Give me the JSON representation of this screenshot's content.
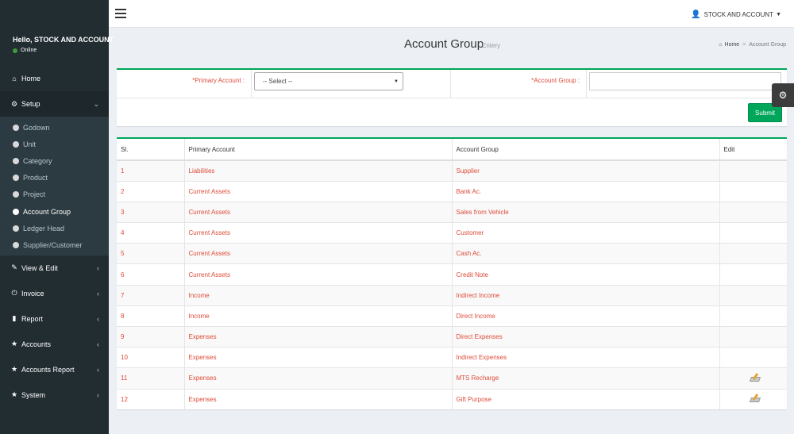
{
  "sidebar": {
    "user_name": "Hello, STOCK AND ACCOUNT",
    "status": "Online",
    "menu": [
      {
        "label": "Home",
        "icon": "home-icon"
      },
      {
        "label": "Setup",
        "icon": "gears-icon"
      },
      {
        "label": "View & Edit",
        "icon": "edit-icon"
      },
      {
        "label": "Invoice",
        "icon": "plug-icon"
      },
      {
        "label": "Report",
        "icon": "file-icon"
      },
      {
        "label": "Accounts",
        "icon": "star-icon"
      },
      {
        "label": "Accounts Report",
        "icon": "star-icon"
      },
      {
        "label": "System",
        "icon": "star-icon"
      }
    ],
    "setup_items": [
      "Godown",
      "Unit",
      "Category",
      "Product",
      "Project",
      "Account Group",
      "Ledger Head",
      "Supplier/Customer"
    ]
  },
  "header": {
    "user_menu": "STOCK AND ACCOUNT"
  },
  "page": {
    "title": "Account Group",
    "subtitle": "Entery",
    "breadcrumb_home": "Home",
    "breadcrumb_current": "Account Group"
  },
  "form": {
    "primary_label": "*Primary Account :",
    "primary_value": "-- Select --",
    "group_label": "*Account Group :",
    "group_value": "",
    "submit_label": "Submit"
  },
  "table": {
    "headers": [
      "Sl.",
      "Primary Account",
      "Account Group",
      "Edit"
    ],
    "rows": [
      {
        "sl": "1",
        "primary": "Liabilities",
        "group": "Supplier",
        "editable": false
      },
      {
        "sl": "2",
        "primary": "Current Assets",
        "group": "Bank Ac.",
        "editable": false
      },
      {
        "sl": "3",
        "primary": "Current Assets",
        "group": "Sales from Vehicle",
        "editable": false
      },
      {
        "sl": "4",
        "primary": "Current Assets",
        "group": "Customer",
        "editable": false
      },
      {
        "sl": "5",
        "primary": "Current Assets",
        "group": "Cash Ac.",
        "editable": false
      },
      {
        "sl": "6",
        "primary": "Current Assets",
        "group": "Credit Note",
        "editable": false
      },
      {
        "sl": "7",
        "primary": "Income",
        "group": "Indirect Income",
        "editable": false
      },
      {
        "sl": "8",
        "primary": "Income",
        "group": "Direct Income",
        "editable": false
      },
      {
        "sl": "9",
        "primary": "Expenses",
        "group": "Direct Expenses",
        "editable": false
      },
      {
        "sl": "10",
        "primary": "Expenses",
        "group": "Indirect Expenses",
        "editable": false
      },
      {
        "sl": "11",
        "primary": "Expenses",
        "group": "MTS Recharge",
        "editable": true
      },
      {
        "sl": "12",
        "primary": "Expenses",
        "group": "Gift Purpose",
        "editable": true
      }
    ]
  },
  "colors": {
    "sidebar_bg": "#222d32",
    "accent_green": "#00a65a",
    "link_red": "#dd4b39"
  }
}
